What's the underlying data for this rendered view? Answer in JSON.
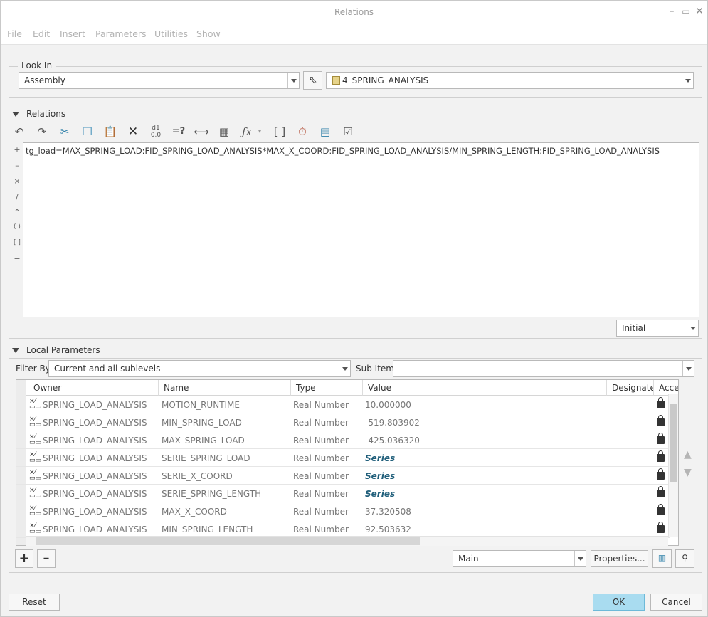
{
  "window": {
    "title": "Relations"
  },
  "menu": [
    "File",
    "Edit",
    "Insert",
    "Parameters",
    "Utilities",
    "Show"
  ],
  "look_in": {
    "label": "Look In",
    "scope": "Assembly",
    "model": "4_SPRING_ANALYSIS"
  },
  "relations": {
    "label": "Relations",
    "text": "tg_load=MAX_SPRING_LOAD:FID_SPRING_LOAD_ANALYSIS*MAX_X_COORD:FID_SPRING_LOAD_ANALYSIS/MIN_SPRING_LENGTH:FID_SPRING_LOAD_ANALYSIS",
    "operators": [
      "+",
      "–",
      "×",
      "/",
      "^",
      "( )",
      "[ ]",
      "="
    ],
    "mode": "Initial"
  },
  "local_params": {
    "label": "Local Parameters",
    "filter_label": "Filter By",
    "filter_value": "Current and all sublevels",
    "sub_items_label": "Sub Items",
    "columns": [
      "Owner",
      "Name",
      "Type",
      "Value",
      "Designate",
      "Acce"
    ],
    "rows": [
      {
        "owner": "SPRING_LOAD_ANALYSIS",
        "name": "MOTION_RUNTIME",
        "type": "Real Number",
        "value": "10.000000",
        "series": false
      },
      {
        "owner": "SPRING_LOAD_ANALYSIS",
        "name": "MIN_SPRING_LOAD",
        "type": "Real Number",
        "value": "-519.803902",
        "series": false
      },
      {
        "owner": "SPRING_LOAD_ANALYSIS",
        "name": "MAX_SPRING_LOAD",
        "type": "Real Number",
        "value": "-425.036320",
        "series": false
      },
      {
        "owner": "SPRING_LOAD_ANALYSIS",
        "name": "SERIE_SPRING_LOAD",
        "type": "Real Number",
        "value": "Series",
        "series": true
      },
      {
        "owner": "SPRING_LOAD_ANALYSIS",
        "name": "SERIE_X_COORD",
        "type": "Real Number",
        "value": "Series",
        "series": true
      },
      {
        "owner": "SPRING_LOAD_ANALYSIS",
        "name": "SERIE_SPRING_LENGTH",
        "type": "Real Number",
        "value": "Series",
        "series": true
      },
      {
        "owner": "SPRING_LOAD_ANALYSIS",
        "name": "MAX_X_COORD",
        "type": "Real Number",
        "value": "37.320508",
        "series": false
      },
      {
        "owner": "SPRING_LOAD_ANALYSIS",
        "name": "MIN_SPRING_LENGTH",
        "type": "Real Number",
        "value": "92.503632",
        "series": false
      }
    ],
    "view": "Main",
    "properties_label": "Properties..."
  },
  "footer": {
    "reset": "Reset",
    "ok": "OK",
    "cancel": "Cancel"
  }
}
